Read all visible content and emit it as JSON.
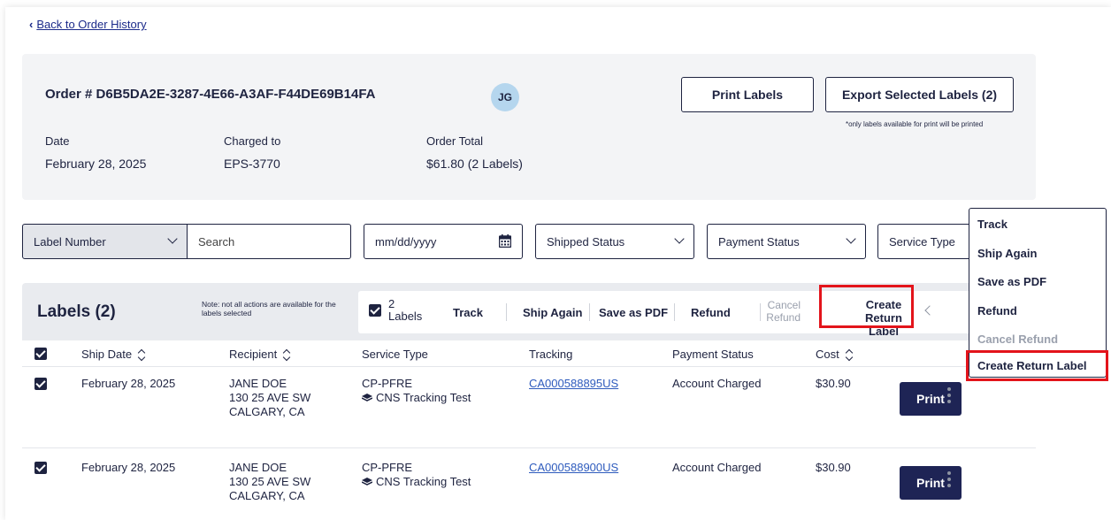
{
  "back_link": "Back to Order History",
  "order": {
    "title": "Order # D6B5DA2E-3287-4E66-A3AF-F44DE69B14FA",
    "avatar_initials": "JG",
    "print_labels_button": "Print Labels",
    "export_button": "Export Selected Labels (2)",
    "footnote": "*only labels available for print will be printed",
    "date_label": "Date",
    "date_value": "February 28, 2025",
    "charged_label": "Charged to",
    "charged_value": "EPS-3770",
    "total_label": "Order Total",
    "total_value": "$61.80 (2 Labels)"
  },
  "filters": {
    "label_number": "Label Number",
    "search_placeholder": "Search",
    "date_placeholder": "mm/dd/yyyy",
    "shipped_status": "Shipped Status",
    "payment_status": "Payment Status",
    "service_type": "Service Type"
  },
  "labels": {
    "title": "Labels (2)",
    "note": "Note: not all actions are available for the labels selected",
    "selected_count": "2",
    "selected_unit": "Labels",
    "actions": {
      "track": "Track",
      "ship_again": "Ship Again",
      "save_pdf": "Save as PDF",
      "refund": "Refund",
      "cancel_refund_1": "Cancel",
      "cancel_refund_2": "Refund",
      "create_return_1": "Create",
      "create_return_2": "Return Label"
    }
  },
  "table": {
    "headers": {
      "ship_date": "Ship Date",
      "recipient": "Recipient",
      "service_type": "Service Type",
      "tracking": "Tracking",
      "payment_status": "Payment Status",
      "cost": "Cost"
    },
    "rows": [
      {
        "ship_date": "February 28, 2025",
        "recipient_name": "JANE DOE",
        "recipient_addr": "130 25 AVE SW",
        "recipient_city": "CALGARY, CA",
        "service_code": "CP-PFRE",
        "service_note": "CNS Tracking Test",
        "tracking": "CA000588895US",
        "payment_status": "Account Charged",
        "cost": "$30.90",
        "print": "Print"
      },
      {
        "ship_date": "February 28, 2025",
        "recipient_name": "JANE DOE",
        "recipient_addr": "130 25 AVE SW",
        "recipient_city": "CALGARY, CA",
        "service_code": "CP-PFRE",
        "service_note": "CNS Tracking Test",
        "tracking": "CA000588900US",
        "payment_status": "Account Charged",
        "cost": "$30.90",
        "print": "Print"
      }
    ]
  },
  "menu": {
    "items": [
      "Track",
      "Ship Again",
      "Save as PDF",
      "Refund",
      "Cancel Refund",
      "Create Return Label"
    ]
  },
  "colors": {
    "primary": "#1e2455",
    "highlight": "#e3141b",
    "link": "#2e5bbd",
    "panel": "#f3f4f6"
  }
}
